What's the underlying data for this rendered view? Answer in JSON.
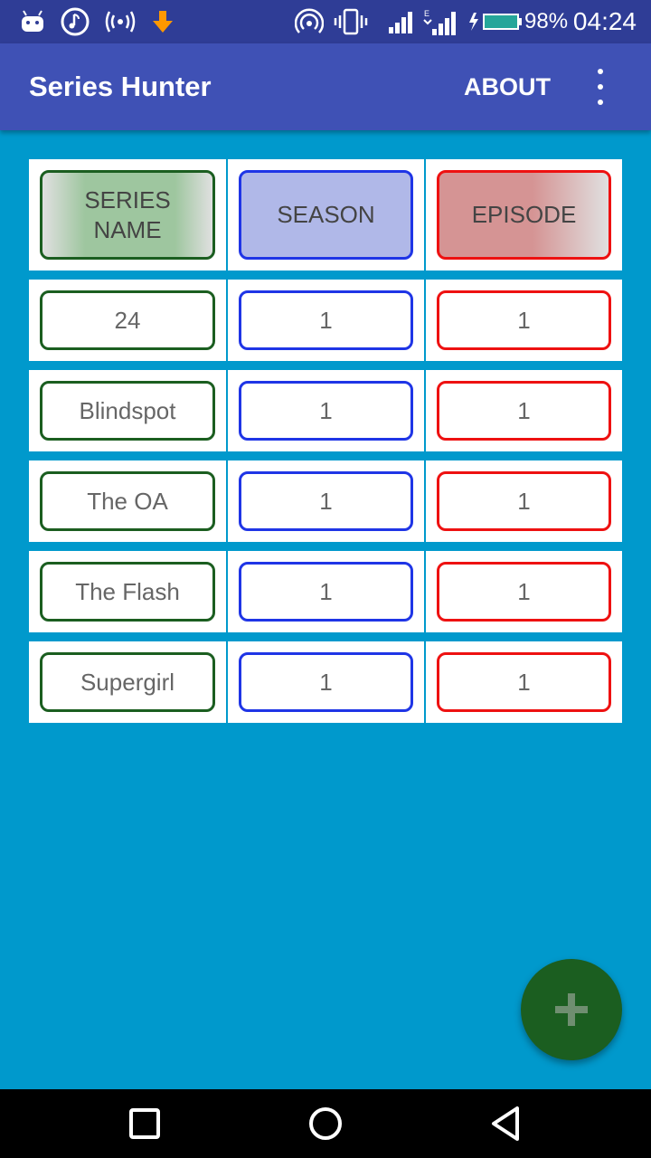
{
  "status_bar": {
    "battery_percent": "98%",
    "time": "04:24",
    "icons": [
      "android-icon",
      "music-note-icon",
      "broadcast-icon",
      "download-arrow-icon",
      "hotspot-icon",
      "vibrate-icon",
      "signal-icon",
      "data-signal-icon",
      "battery-charging-icon"
    ]
  },
  "app_bar": {
    "title": "Series Hunter",
    "about_label": "ABOUT",
    "menu_icon": "more-vert-icon"
  },
  "table": {
    "headers": [
      "SERIES NAME",
      "SEASON",
      "EPISODE"
    ],
    "rows": [
      {
        "name": "24",
        "season": "1",
        "episode": "1"
      },
      {
        "name": "Blindspot",
        "season": "1",
        "episode": "1"
      },
      {
        "name": "The OA",
        "season": "1",
        "episode": "1"
      },
      {
        "name": "The Flash",
        "season": "1",
        "episode": "1"
      },
      {
        "name": "Supergirl",
        "season": "1",
        "episode": "1"
      }
    ]
  },
  "fab": {
    "icon": "plus-icon"
  },
  "nav_bar": {
    "icons": [
      "recent-apps-icon",
      "home-icon",
      "back-icon"
    ]
  },
  "colors": {
    "background": "#0099cc",
    "app_bar": "#3f51b5",
    "status_bar": "#2f3d96",
    "series_border": "#1b5e20",
    "season_border": "#1f35e6",
    "episode_border": "#ee1111",
    "fab": "#1b5e20"
  }
}
